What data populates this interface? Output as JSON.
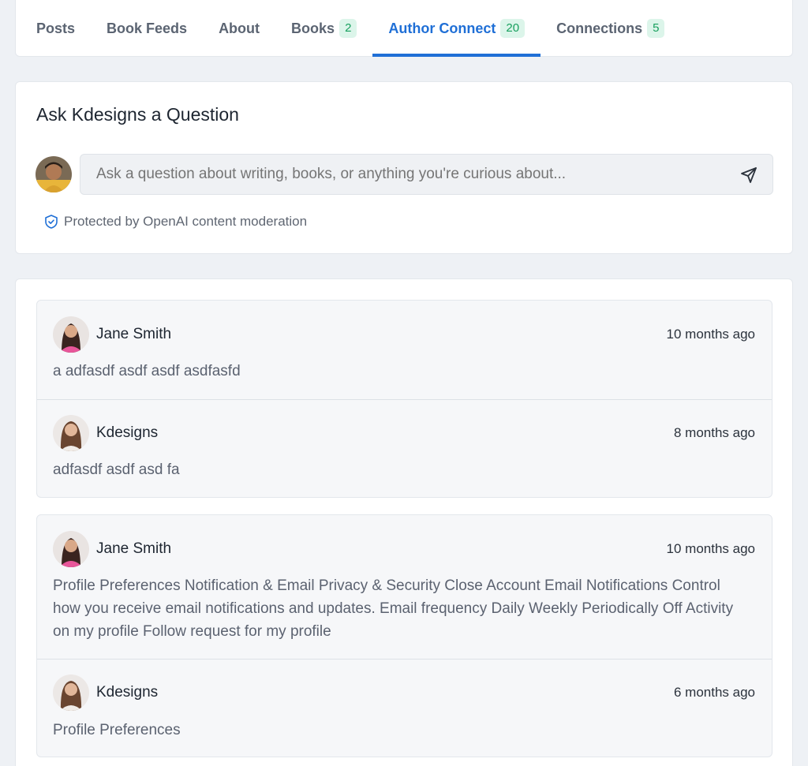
{
  "tabs": [
    {
      "label": "Posts"
    },
    {
      "label": "Book Feeds"
    },
    {
      "label": "About"
    },
    {
      "label": "Books",
      "count": "2"
    },
    {
      "label": "Author Connect",
      "count": "20"
    },
    {
      "label": "Connections",
      "count": "5"
    }
  ],
  "ask": {
    "title": "Ask Kdesigns a Question",
    "placeholder": "Ask a question about writing, books, or anything you're curious about...",
    "moderation": "Protected by OpenAI content moderation"
  },
  "threads": [
    {
      "messages": [
        {
          "name": "Jane Smith",
          "time": "10 months ago",
          "body": "a adfasdf asdf asdf asdfasfd"
        },
        {
          "name": "Kdesigns",
          "time": "8 months ago",
          "body": "adfasdf asdf asd fa"
        }
      ]
    },
    {
      "messages": [
        {
          "name": "Jane Smith",
          "time": "10 months ago",
          "body": "Profile Preferences Notification & Email Privacy & Security Close Account Email Notifications Control how you receive email notifications and updates. Email frequency Daily Weekly Periodically Off Activity on my profile Follow request for my profile"
        },
        {
          "name": "Kdesigns",
          "time": "6 months ago",
          "body": "Profile Preferences"
        }
      ]
    }
  ],
  "colors": {
    "accent": "#1f6fd6",
    "badge_bg": "#dcf5ea",
    "badge_text": "#18a05e",
    "background": "#eef1f5"
  }
}
